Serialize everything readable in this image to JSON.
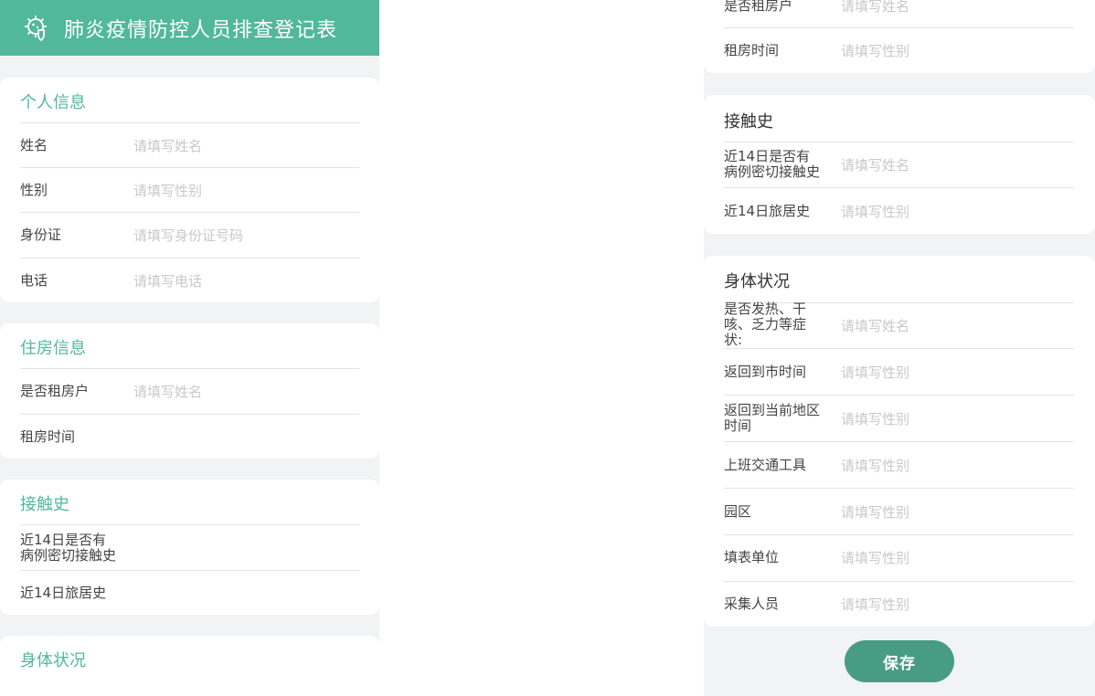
{
  "header": {
    "title": "肺炎疫情防控人员排查登记表",
    "logo_icon": "shield-virus-icon"
  },
  "colors": {
    "accent": "#51b89b",
    "button": "#489c84",
    "placeholder": "#c8c8c8"
  },
  "left": {
    "personal": {
      "title": "个人信息",
      "fields": [
        {
          "label": "姓名",
          "placeholder": "请填写姓名"
        },
        {
          "label": "性别",
          "placeholder": "请填写性别"
        },
        {
          "label": "身份证",
          "placeholder": "请填写身份证号码"
        },
        {
          "label": "电话",
          "placeholder": "请填写电话"
        }
      ]
    },
    "housing": {
      "title": "住房信息",
      "fields": [
        {
          "label": "是否租房户",
          "placeholder": "请填写姓名"
        },
        {
          "label": "租房时间",
          "placeholder": ""
        }
      ]
    },
    "contact": {
      "title": "接触史",
      "fields": [
        {
          "label_line1": "近14日是否有",
          "label_line2": "病例密切接触史",
          "placeholder": ""
        },
        {
          "label": "近14日旅居史",
          "placeholder": ""
        }
      ]
    },
    "health": {
      "title": "身体状况"
    }
  },
  "right": {
    "housing": {
      "fields": [
        {
          "label": "是否租房户",
          "placeholder": "请填写姓名"
        },
        {
          "label": "租房时间",
          "placeholder": "请填写性别"
        }
      ]
    },
    "contact": {
      "title": "接触史",
      "fields": [
        {
          "label_line1": "近14日是否有",
          "label_line2": "病例密切接触史",
          "placeholder": "请填写姓名"
        },
        {
          "label": "近14日旅居史",
          "placeholder": "请填写性别"
        }
      ]
    },
    "health": {
      "title": "身体状况",
      "fields": [
        {
          "label_line1": "是否发热、干",
          "label_line2": "咳、乏力等症",
          "label_line3": "状:",
          "placeholder": "请填写姓名"
        },
        {
          "label": "返回到市时间",
          "placeholder": "请填写性别"
        },
        {
          "label_line1": "返回到当前地区",
          "label_line2": "时间",
          "placeholder": "请填写性别"
        },
        {
          "label": "上班交通工具",
          "placeholder": "请填写性别"
        },
        {
          "label": "园区",
          "placeholder": "请填写性别"
        },
        {
          "label": "填表单位",
          "placeholder": "请填写性别"
        },
        {
          "label": "采集人员",
          "placeholder": "请填写性别"
        }
      ]
    },
    "save_label": "保存"
  }
}
